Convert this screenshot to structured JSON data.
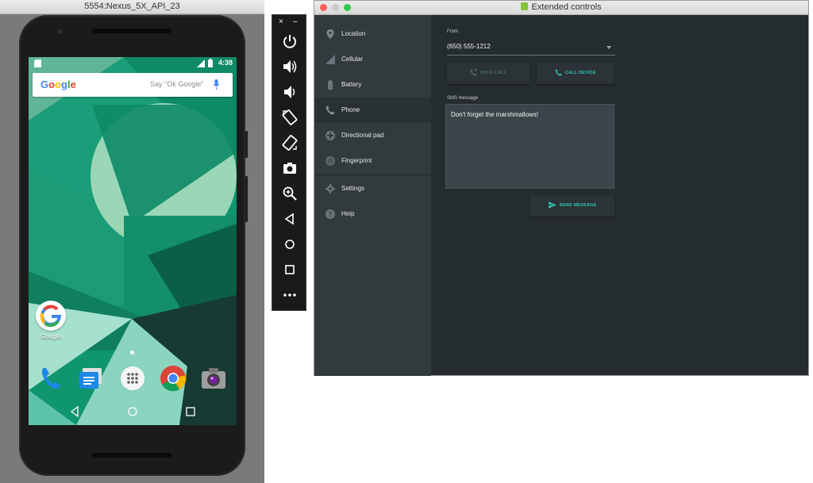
{
  "emulator": {
    "window_title": "5554:Nexus_5X_API_23",
    "status_time": "4:38",
    "search": {
      "logo": "Google",
      "hint": "Say \"Ok Google\""
    },
    "home_app_label": "Google",
    "dock_icons": [
      "phone-icon",
      "messages-icon",
      "app-drawer-icon",
      "chrome-icon",
      "camera-icon"
    ],
    "nav_icons": [
      "back-icon",
      "home-icon",
      "recents-icon"
    ]
  },
  "toolbar": {
    "close": "×",
    "minimize": "–",
    "buttons": [
      "power-icon",
      "volume-up-icon",
      "volume-down-icon",
      "rotate-left-icon",
      "rotate-right-icon",
      "camera-icon",
      "zoom-icon",
      "back-icon",
      "home-icon",
      "overview-icon",
      "more-icon"
    ]
  },
  "extended": {
    "window_title": "Extended controls",
    "nav": [
      {
        "label": "Location",
        "icon": "location-pin-icon"
      },
      {
        "label": "Cellular",
        "icon": "signal-icon"
      },
      {
        "label": "Battery",
        "icon": "battery-icon"
      },
      {
        "label": "Phone",
        "icon": "phone-icon"
      },
      {
        "label": "Directional pad",
        "icon": "dpad-icon"
      },
      {
        "label": "Fingerprint",
        "icon": "fingerprint-icon"
      },
      {
        "label": "Settings",
        "icon": "gear-icon"
      },
      {
        "label": "Help",
        "icon": "help-icon"
      }
    ],
    "active_nav": "Phone",
    "phone": {
      "from_label": "From",
      "from_value": "(650) 555-1212",
      "hold_call": "HOLD CALL",
      "call_device": "CALL DEVICE",
      "sms_label": "SMS message",
      "sms_value": "Don't forget the marshmallows!",
      "send_message": "SEND MESSAGE"
    },
    "colors": {
      "accent": "#2fc4b2",
      "sidebar": "#323a3e",
      "content": "#252c30"
    }
  }
}
